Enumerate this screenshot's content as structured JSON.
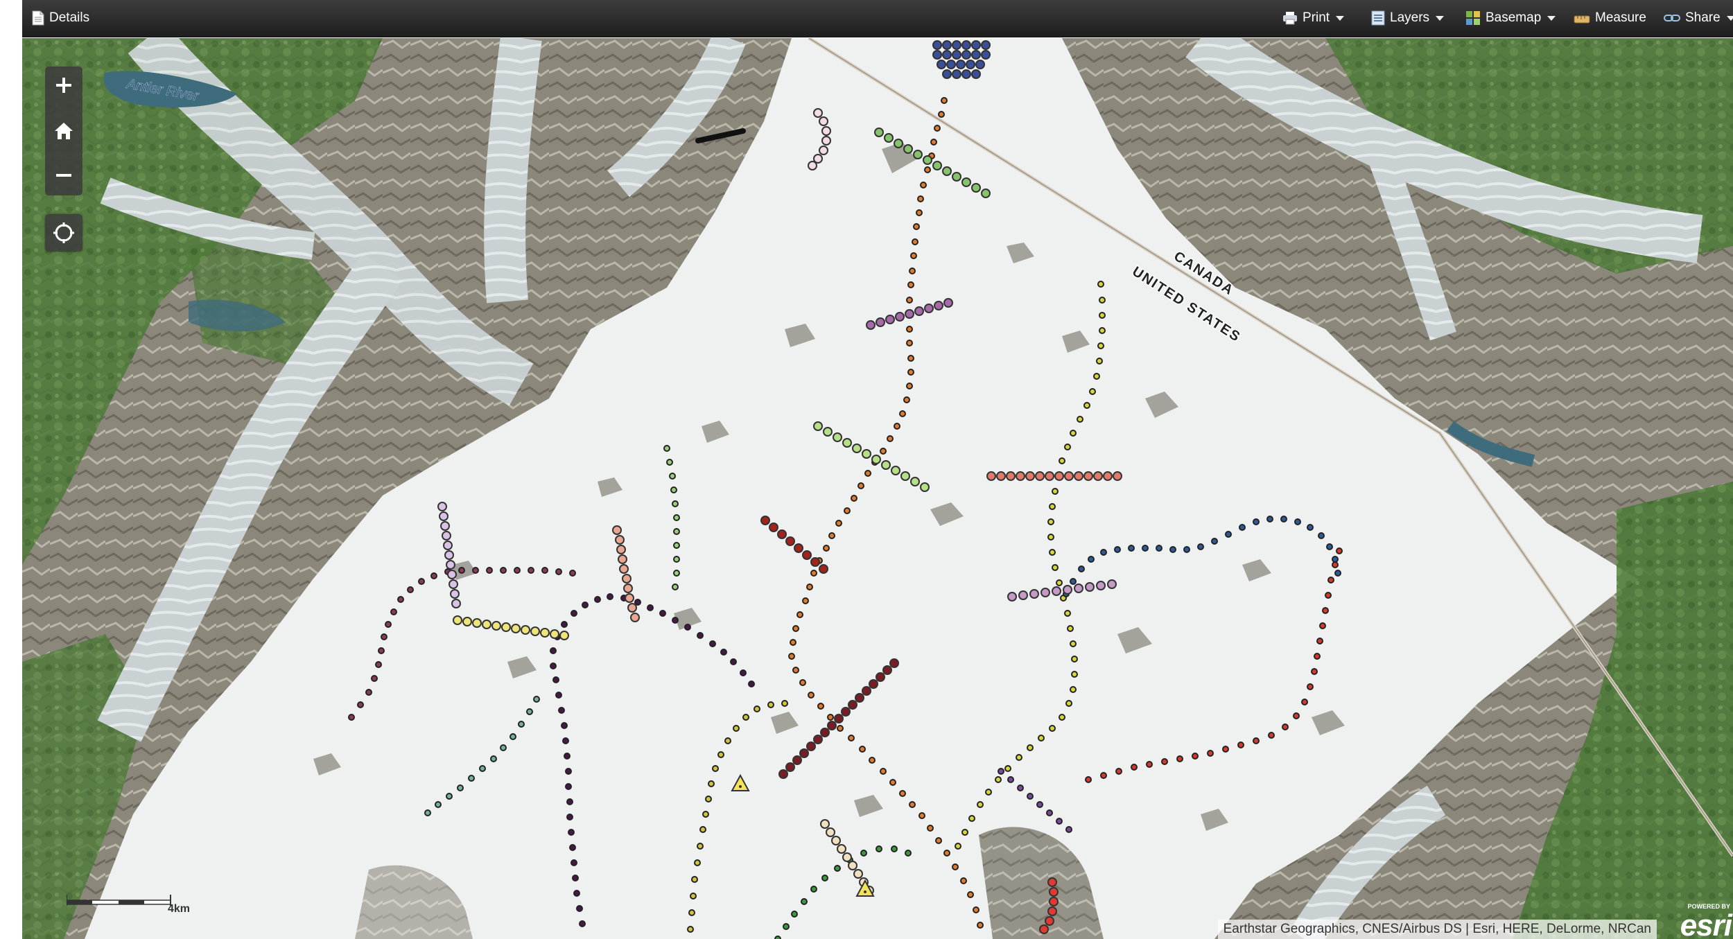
{
  "toolbar": {
    "details_label": "Details",
    "print_label": "Print",
    "layers_label": "Layers",
    "basemap_label": "Basemap",
    "measure_label": "Measure",
    "share_label": "Share"
  },
  "map": {
    "labels": {
      "river": "Antler River",
      "canada": "CANADA",
      "united_states": "UNITED STATES"
    },
    "scale_label": "4km",
    "attribution": "Earthstar Geographics, CNES/Airbus DS | Esri, HERE, DeLorme, NRCan",
    "logo": {
      "powered_by": "POWERED BY",
      "wordmark": "esri"
    },
    "controls": [
      "zoom-in",
      "home",
      "zoom-out",
      "locate"
    ],
    "colors": {
      "glacier": "#eef0f0",
      "rock": "#8e8b80",
      "vegetation": "#4b7a3a",
      "water": "#3a6d80",
      "border": "#d8cfc0"
    }
  }
}
